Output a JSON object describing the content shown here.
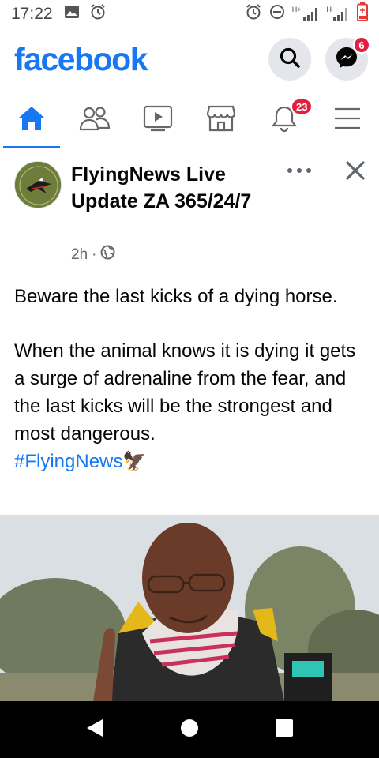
{
  "status": {
    "time": "17:22",
    "left_icons": [
      "image-icon",
      "alarm-icon"
    ],
    "right_icons": [
      "alarm-icon",
      "do-not-disturb-icon",
      "signal-hplus-icon",
      "signal-h-icon",
      "battery-low-icon"
    ],
    "net1": "H+",
    "net2": "H"
  },
  "header": {
    "logo": "facebook",
    "messenger_badge": "6"
  },
  "tabs": {
    "items": [
      "home-icon",
      "friends-icon",
      "watch-icon",
      "marketplace-icon",
      "notifications-icon",
      "menu-icon"
    ],
    "active": "home",
    "notifications_badge": "23"
  },
  "post": {
    "author": "FlyingNews Live Update ZA 365/24/7",
    "time": "2h",
    "separator": "·",
    "privacy_icon": "globe-icon",
    "text_p1": "Beware the last kicks of a dying horse.",
    "text_p2": "When the animal knows it is dying it gets a surge of adrenaline from the fear, and the last kicks will be the strongest and most dangerous.",
    "hashtag": "#FlyingNews",
    "emoji": "🦅"
  },
  "colors": {
    "brand": "#1877f2",
    "badge": "#e41e3f",
    "icon_gray": "#65676b"
  },
  "navbar": {
    "items": [
      "back-icon",
      "home-circle-icon",
      "recents-icon"
    ]
  }
}
